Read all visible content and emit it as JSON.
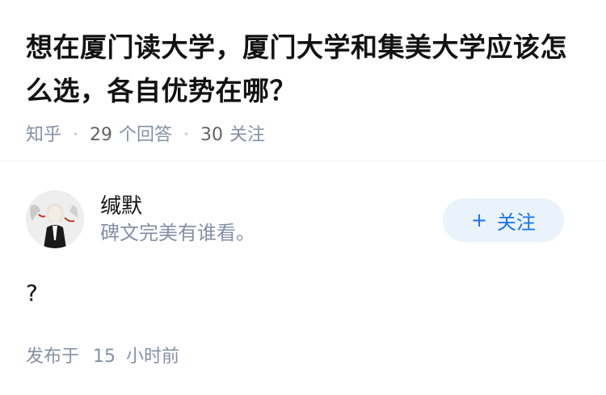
{
  "question": {
    "title": "想在厦门读大学，厦门大学和集美大学应该怎么选，各自优势在哪？",
    "source": "知乎",
    "answer_count": "29",
    "answer_label": "个回答",
    "follower_count": "30",
    "follower_label": "关注"
  },
  "answer": {
    "author": {
      "name": "缄默",
      "bio": "碑文完美有谁看。",
      "avatar_icon": "avatar-anime-character"
    },
    "follow_button": {
      "icon": "+",
      "label": "关注"
    },
    "content": "?",
    "published": "发布于",
    "time_value": "15",
    "time_unit": "小时前"
  },
  "colors": {
    "title": "#121212",
    "meta": "#8590a6",
    "accent": "#1772f6",
    "follow_bg": "#eaf2fb"
  }
}
